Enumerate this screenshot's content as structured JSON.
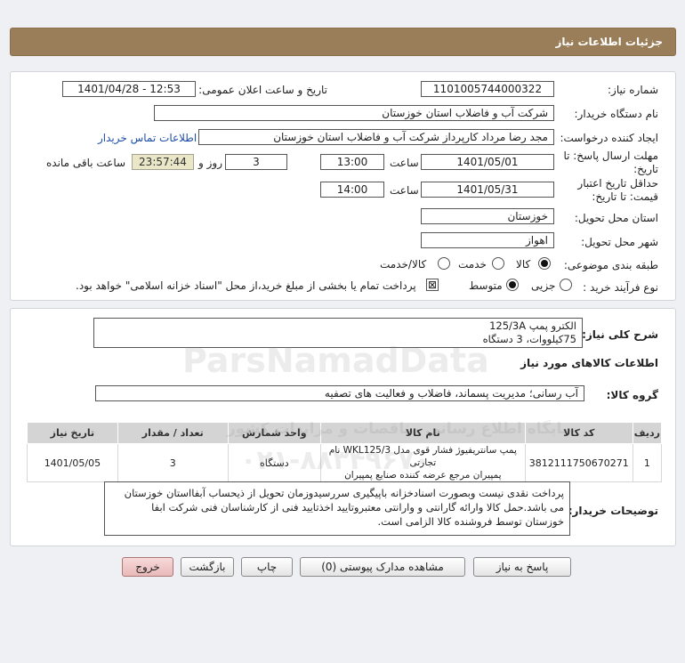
{
  "header": {
    "title": "جزئیات اطلاعات نیاز"
  },
  "form": {
    "need_number_label": "شماره نیاز:",
    "need_number": "1101005744000322",
    "announce_label": "تاریخ و ساعت اعلان عمومی:",
    "announce_value": "1401/04/28 - 12:53",
    "buyer_label": "نام دستگاه خریدار:",
    "buyer_value": "شرکت آب و فاضلاب استان خوزستان",
    "creator_label": "ایجاد کننده درخواست:",
    "creator_value": "مجد رضا مرداد کارپرداز شرکت آب و فاضلاب استان خوزستان",
    "contact_link": "اطلاعات تماس خریدار",
    "deadline_label_1": "مهلت ارسال پاسخ: تا",
    "deadline_label_2": "تاریخ:",
    "deadline_date": "1401/05/01",
    "time_label": "ساعت",
    "deadline_time": "13:00",
    "days_value": "3",
    "days_label": "روز و",
    "remaining_timer": "23:57:44",
    "remaining_label": "ساعت باقی مانده",
    "validity_label_1": "حداقل تاریخ اعتبار",
    "validity_label_2": "قیمت: تا تاریخ:",
    "validity_date": "1401/05/31",
    "validity_time_label": "ساعت",
    "validity_time": "14:00",
    "province_label": "استان محل تحویل:",
    "province_value": "خوزستان",
    "city_label": "شهر محل تحویل:",
    "city_value": "اهواز",
    "category_label": "طبقه بندی موضوعی:",
    "category_options": [
      "کالا",
      "خدمت",
      "کالا/خدمت"
    ],
    "purchase_type_label": "نوع فرآیند خرید :",
    "purchase_options": [
      "جزیی",
      "متوسط"
    ],
    "treasury_note": "پرداخت تمام یا بخشی از مبلغ خرید،از محل \"اسناد خزانه اسلامی\" خواهد بود."
  },
  "description": {
    "label": "شرح کلی نیاز:",
    "line1": "الکترو پمپ 125/3A",
    "line2": "75کیلووات، 3 دستگاه"
  },
  "goods": {
    "section_title": "اطلاعات کالاهای مورد نیاز",
    "group_label": "گروه کالا:",
    "group_value": "آب رسانی؛ مدیریت پسماند، فاضلاب و فعالیت های تصفیه",
    "columns": [
      "ردیف",
      "کد کالا",
      "نام کالا",
      "واحد شمارش",
      "تعداد / مقدار",
      "تاریخ نیاز"
    ],
    "rows": [
      {
        "row": "1",
        "code": "3812111750670271",
        "name_line1": "پمپ سانتریفیوژ فشار قوی مدل WKL125/3 نام تجارتی",
        "name_line2": "پمپیران مرجع عرضه کننده صنایع پمپیران",
        "unit": "دستگاه",
        "qty": "3",
        "date": "1401/05/05"
      }
    ]
  },
  "notes": {
    "label": "توضیحات خریدار:",
    "text": "پرداخت نقدی نیست وبصورت اسنادخزانه باپیگیری سررسیدوزمان تحویل از ذیحساب آبفااستان خوزستان می باشد.حمل کالا وارائه گارانتی و وارانتی معتبروتایید اخذتایید فنی از کارشناسان فنی شرکت ابفا خوزستان توسط فروشنده کالا الزامی است."
  },
  "buttons": {
    "reply": "پاسخ به نیاز",
    "attachments": "مشاهده مدارک پیوستی (0)",
    "print": "چاپ",
    "back": "بازگشت",
    "exit": "خروج"
  },
  "watermark": {
    "brand": "ParsNamadData",
    "line_fa": "پایگاه اطلاع رسانی مناقصات و مزایدات کشور",
    "phone": "۰۲۱-۸۸۳۴۹۶۷۰"
  },
  "colors": {
    "header_bg": "#9a7e59",
    "page_bg": "#eef0f3",
    "link": "#1f4fa8",
    "timer_bg": "#eae6c8",
    "exit_button": "#e9b9b9"
  }
}
